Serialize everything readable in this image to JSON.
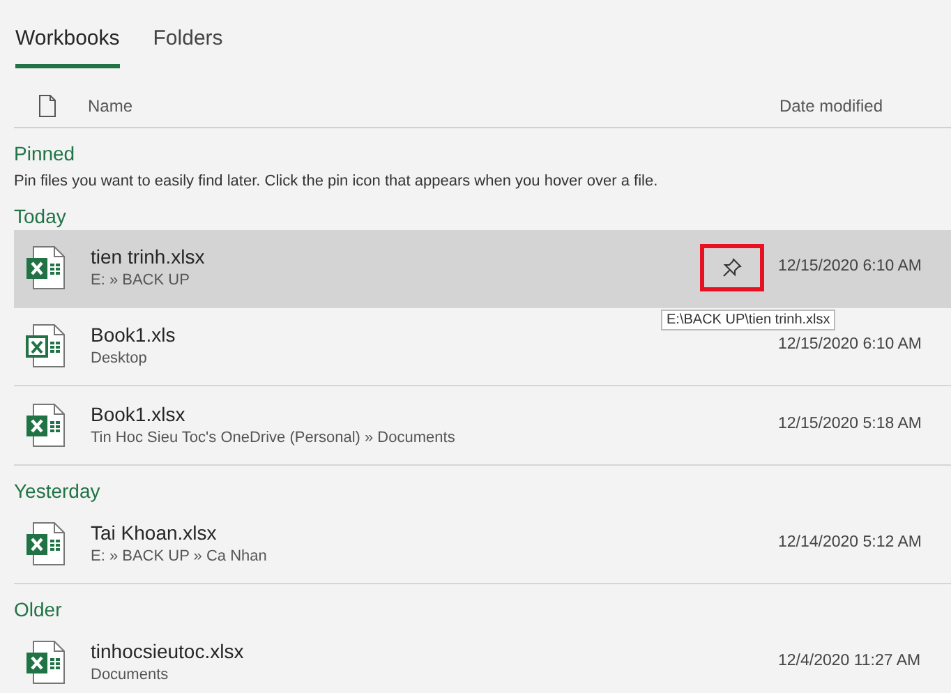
{
  "tabs": [
    {
      "label": "Workbooks",
      "selected": true
    },
    {
      "label": "Folders",
      "selected": false
    }
  ],
  "columns": {
    "name": "Name",
    "date": "Date modified"
  },
  "groups": [
    {
      "title": "Pinned",
      "hint": "Pin files you want to easily find later. Click the pin icon that appears when you hover over a file."
    },
    {
      "title": "Today",
      "files": [
        {
          "name": "tien trinh.xlsx",
          "location": "E: » BACK UP",
          "date": "12/15/2020 6:10 AM",
          "kind": "xlsx",
          "selected": true,
          "pin_highlighted": true,
          "tooltip": "E:\\BACK UP\\tien trinh.xlsx"
        },
        {
          "name": "Book1.xls",
          "location": "Desktop",
          "date": "12/15/2020 6:10 AM",
          "kind": "xls",
          "selected": false
        },
        {
          "name": "Book1.xlsx",
          "location": "Tin Hoc Sieu Toc's OneDrive (Personal) » Documents",
          "date": "12/15/2020 5:18 AM",
          "kind": "xlsx",
          "selected": false
        }
      ]
    },
    {
      "title": "Yesterday",
      "files": [
        {
          "name": "Tai Khoan.xlsx",
          "location": "E: » BACK UP » Ca Nhan",
          "date": "12/14/2020 5:12 AM",
          "kind": "xlsx",
          "selected": false
        }
      ]
    },
    {
      "title": "Older",
      "files": [
        {
          "name": "tinhocsieutoc.xlsx",
          "location": "Documents",
          "date": "12/4/2020 11:27 AM",
          "kind": "xlsx",
          "selected": false
        }
      ]
    }
  ]
}
